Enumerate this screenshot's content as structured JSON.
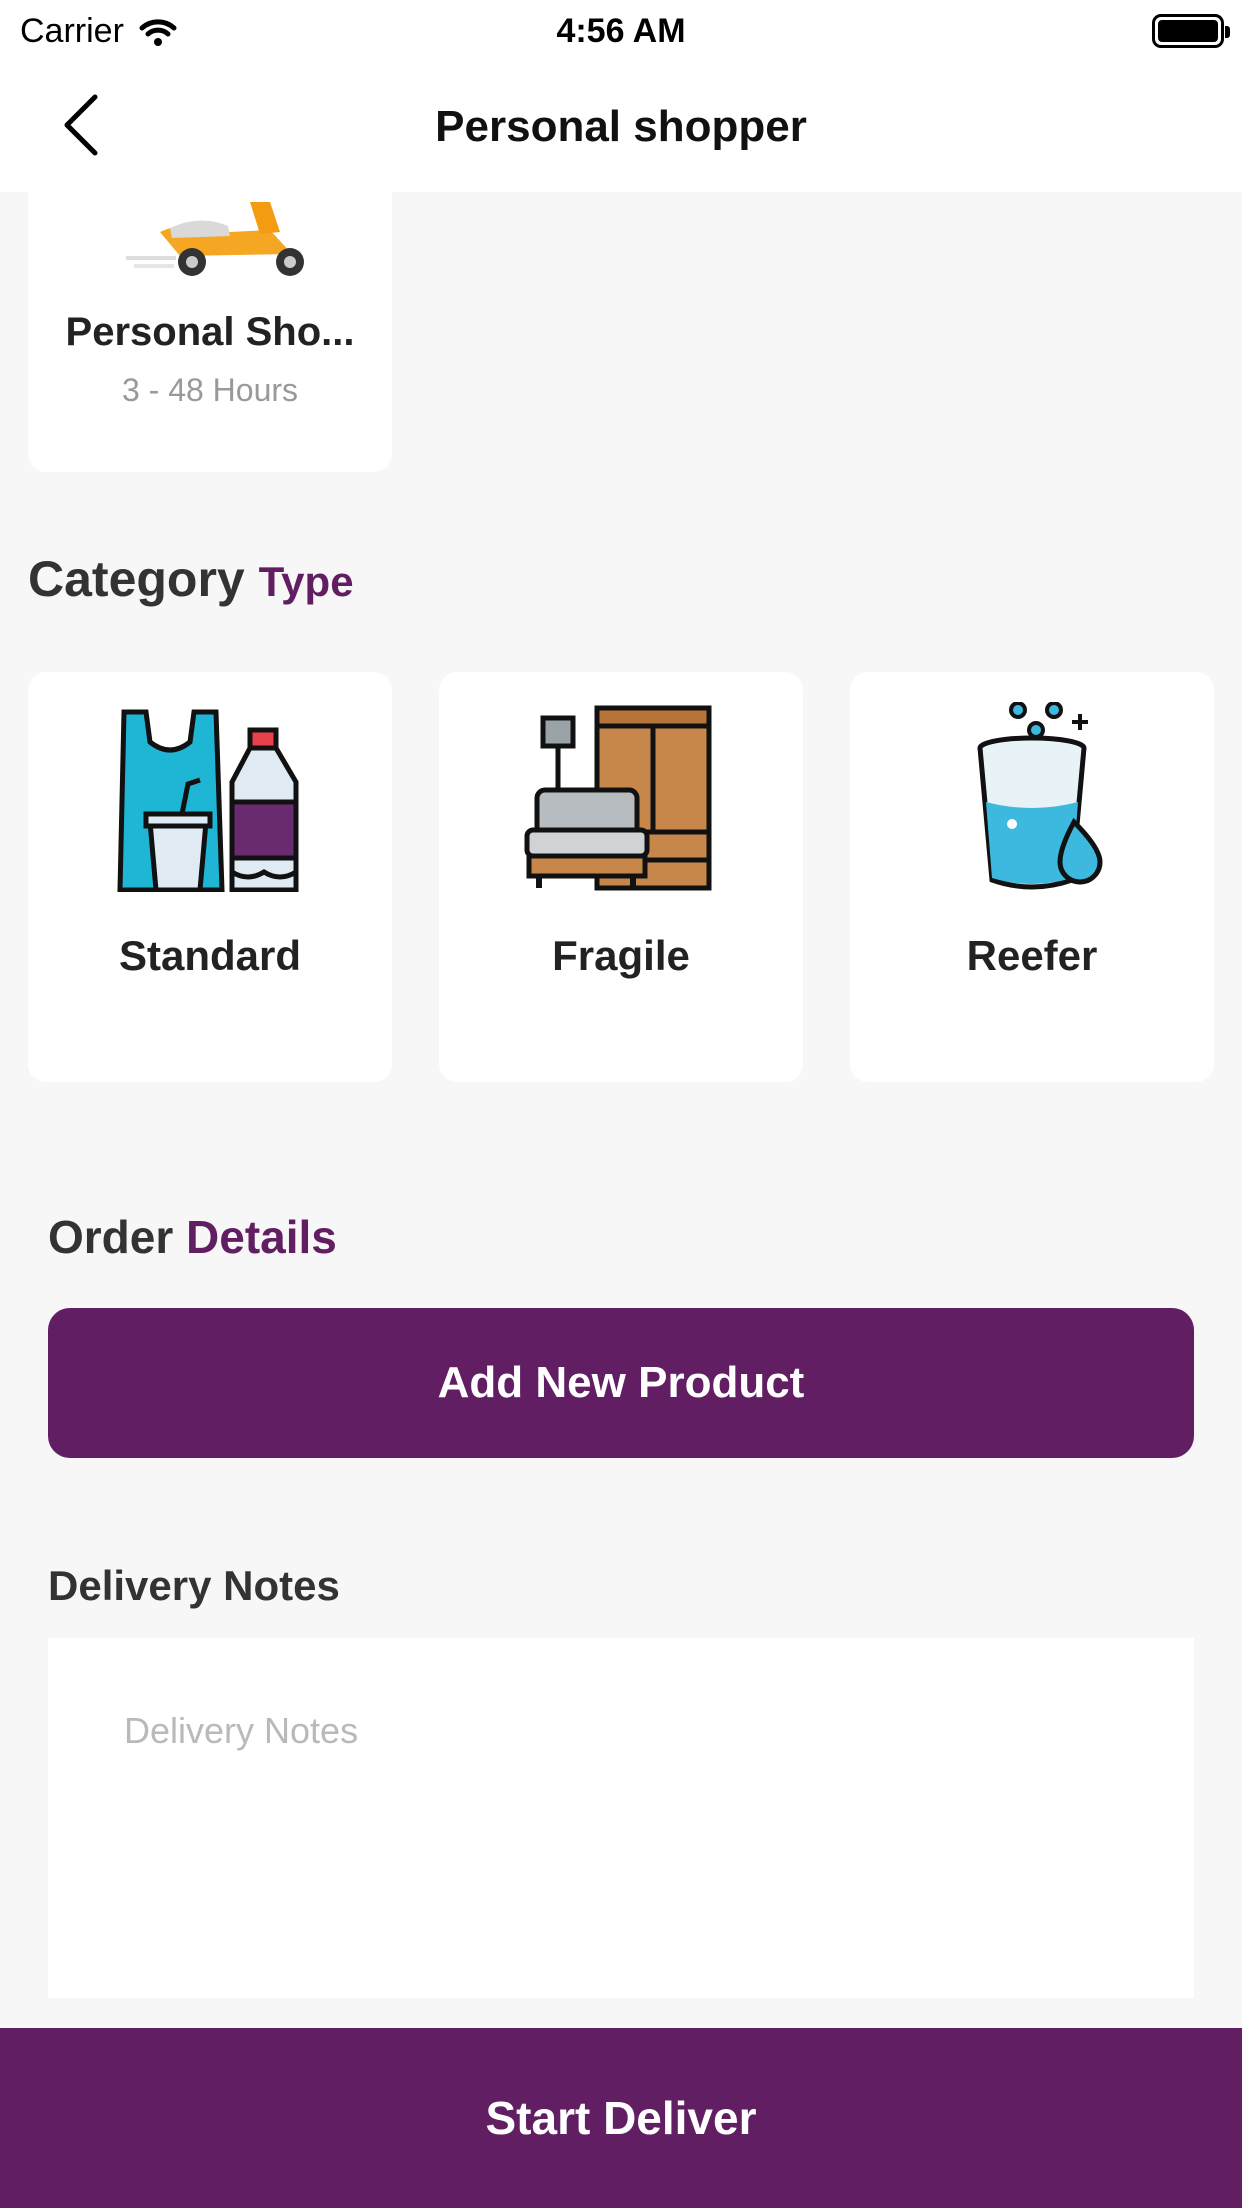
{
  "status_bar": {
    "carrier": "Carrier",
    "time": "4:56 AM"
  },
  "nav": {
    "title": "Personal shopper"
  },
  "service": {
    "name": "Personal Sho...",
    "duration": "3 - 48 Hours"
  },
  "category": {
    "title": "Category",
    "title_accent": "Type",
    "items": [
      {
        "label": "Standard",
        "icon": "bag-bottle-icon"
      },
      {
        "label": "Fragile",
        "icon": "furniture-icon"
      },
      {
        "label": "Reefer",
        "icon": "water-glass-icon"
      }
    ]
  },
  "order": {
    "title": "Order",
    "title_accent": "Details",
    "add_product_label": "Add New Product"
  },
  "notes": {
    "title": "Delivery Notes",
    "placeholder": "Delivery Notes"
  },
  "footer": {
    "start_label": "Start Deliver"
  },
  "colors": {
    "primary": "#611e63",
    "background": "#f7f7f7",
    "card": "#ffffff"
  }
}
